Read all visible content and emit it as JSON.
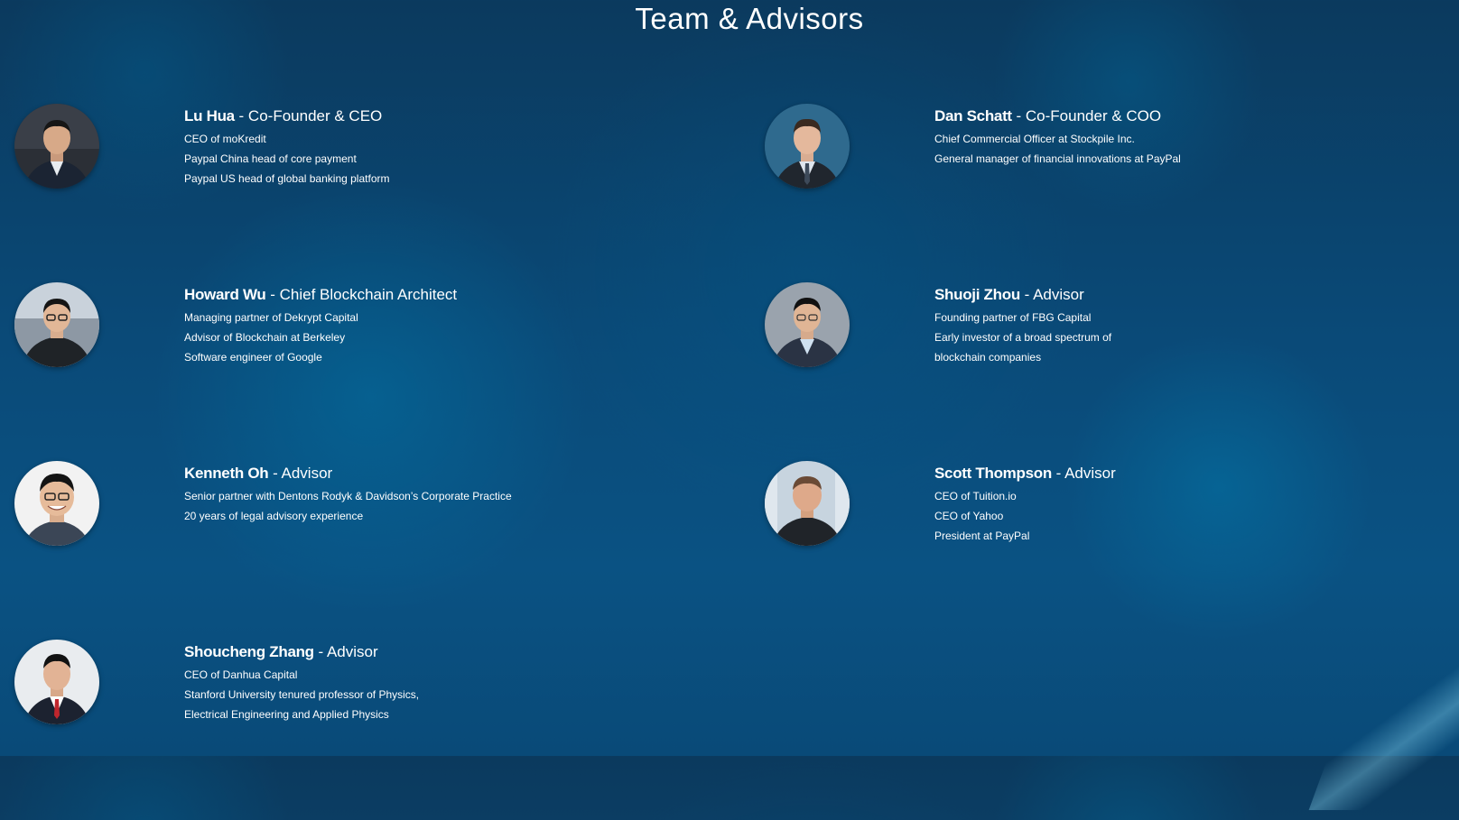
{
  "page": {
    "heading": "Team & Advisors"
  },
  "members": [
    {
      "name": "Lu Hua",
      "role": "Co-Founder & CEO",
      "avatar_icon": "portrait-lu-hua",
      "details": [
        "CEO of moKredit",
        "Paypal China head of core payment",
        "Paypal US head of global banking platform"
      ]
    },
    {
      "name": "Dan Schatt",
      "role": "Co-Founder & COO",
      "avatar_icon": "portrait-dan-schatt",
      "details": [
        "Chief Commercial Officer at Stockpile Inc.",
        "General manager of financial innovations at PayPal"
      ]
    },
    {
      "name": "Howard Wu",
      "role": "Chief Blockchain Architect",
      "avatar_icon": "portrait-howard-wu",
      "details": [
        "Managing partner of Dekrypt Capital",
        "Advisor of Blockchain at Berkeley",
        "Software engineer of Google"
      ]
    },
    {
      "name": "Shuoji Zhou",
      "role": "Advisor",
      "avatar_icon": "portrait-shuoji-zhou",
      "details": [
        "Founding partner of FBG Capital",
        "Early investor of a broad spectrum of",
        "blockchain companies"
      ]
    },
    {
      "name": "Kenneth Oh",
      "role": "Advisor",
      "avatar_icon": "portrait-kenneth-oh",
      "details": [
        "Senior partner with Dentons Rodyk & Davidson’s Corporate Practice",
        "20 years of legal advisory experience"
      ]
    },
    {
      "name": "Scott Thompson",
      "role": "Advisor",
      "avatar_icon": "portrait-scott-thompson",
      "details": [
        "CEO of Tuition.io",
        "CEO of Yahoo",
        "President at PayPal"
      ]
    },
    {
      "name": "Shoucheng Zhang",
      "role": "Advisor",
      "avatar_icon": "portrait-shoucheng-zhang",
      "details": [
        "CEO of Danhua Capital",
        "Stanford University tenured professor of Physics,",
        "Electrical Engineering and Applied Physics"
      ]
    }
  ],
  "colors": {
    "background_top": "#0b3a5e",
    "background_bottom": "#0a5283",
    "text": "#ffffff"
  }
}
